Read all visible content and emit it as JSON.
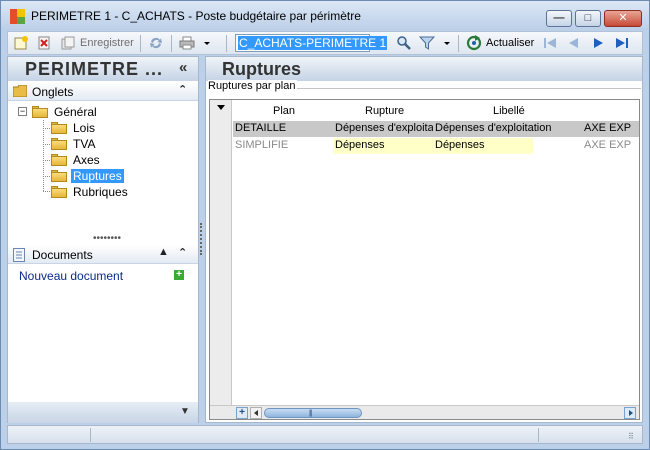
{
  "window": {
    "title": "PERIMETRE 1 - C_ACHATS -  Poste budgétaire par périmètre",
    "minimize_glyph": "—",
    "maximize_glyph": "□",
    "close_glyph": "✕"
  },
  "toolbar": {
    "save_label": "Enregistrer",
    "search_value": "C_ACHATS-PERIMETRE 1",
    "refresh_label": "Actualiser"
  },
  "left_panel": {
    "title": "PERIMETRE ...",
    "collapse_glyph": "«",
    "tabs_section": {
      "label": "Onglets",
      "collapse_glyph": "⌃"
    },
    "tree": {
      "root": "Général",
      "expander_glyph": "−",
      "children": [
        "Lois",
        "TVA",
        "Axes",
        "Ruptures",
        "Rubriques"
      ],
      "selected": "Ruptures"
    },
    "documents_section": {
      "label": "Documents",
      "up_glyph": "▲",
      "collapse_glyph": "⌃",
      "new_document_label": "Nouveau document",
      "add_glyph": "+"
    },
    "bottom_glyph": "▼"
  },
  "right_panel": {
    "title": "Ruptures",
    "group_label": "Ruptures par plan",
    "grid": {
      "columns": [
        "Plan",
        "Rupture",
        "Libellé"
      ],
      "rows": [
        {
          "plan": "DETAILLE",
          "rupture": "Dépenses d'exploita",
          "libelle": "Dépenses d'exploitation",
          "extra": "AXE EXP"
        },
        {
          "plan": "SIMPLIFIE",
          "rupture": "Dépenses",
          "libelle": "Dépenses",
          "extra": "AXE EXP"
        }
      ],
      "add_glyph": "+",
      "scroll_grip": "|||"
    }
  },
  "colors": {
    "selection": "#3399ff",
    "frame": "#bcd0e9",
    "selected_row": "#c8c8c8",
    "highlight_cell": "#ffffc8"
  }
}
